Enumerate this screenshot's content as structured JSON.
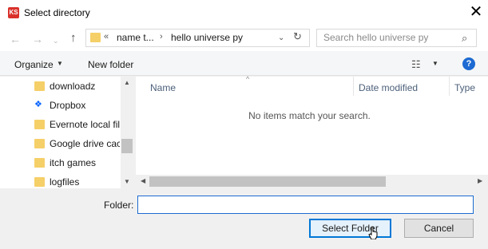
{
  "window": {
    "title": "Select directory",
    "app_icon_text": "KS",
    "close_glyph": "✕"
  },
  "nav": {
    "back_glyph": "←",
    "forward_glyph": "→",
    "recent_glyph": "⌄",
    "up_glyph": "↑",
    "address": {
      "overflow": "«",
      "crumbs": [
        "name t...",
        "hello universe py"
      ],
      "separator": "›",
      "dropdown_glyph": "⌄",
      "refresh_glyph": "↻"
    },
    "search": {
      "placeholder": "Search hello universe py",
      "icon_glyph": "⌕"
    }
  },
  "toolbar": {
    "organize_label": "Organize",
    "caret": "▼",
    "new_folder_label": "New folder",
    "view_glyph": "☷",
    "help_label": "?"
  },
  "sidebar": {
    "items": [
      {
        "label": "downloadz",
        "icon": "folder-icon"
      },
      {
        "label": "Dropbox",
        "icon": "dropbox-icon"
      },
      {
        "label": "Evernote local fil",
        "icon": "folder-icon"
      },
      {
        "label": "Google drive cac",
        "icon": "folder-icon"
      },
      {
        "label": "itch games",
        "icon": "folder-icon"
      },
      {
        "label": "logfiles",
        "icon": "folder-icon"
      }
    ],
    "scroll_up": "▲",
    "scroll_down": "▼"
  },
  "content": {
    "columns": [
      "Name",
      "Date modified",
      "Type"
    ],
    "sort_glyph": "^",
    "empty_message": "No items match your search.",
    "scroll_left": "◀",
    "scroll_right": "▶"
  },
  "footer": {
    "folder_label": "Folder:",
    "folder_value": "",
    "select_label": "Select Folder",
    "cancel_label": "Cancel"
  },
  "colors": {
    "accent": "#0078d7",
    "folder": "#f5cf68",
    "help": "#1c6ad2"
  }
}
